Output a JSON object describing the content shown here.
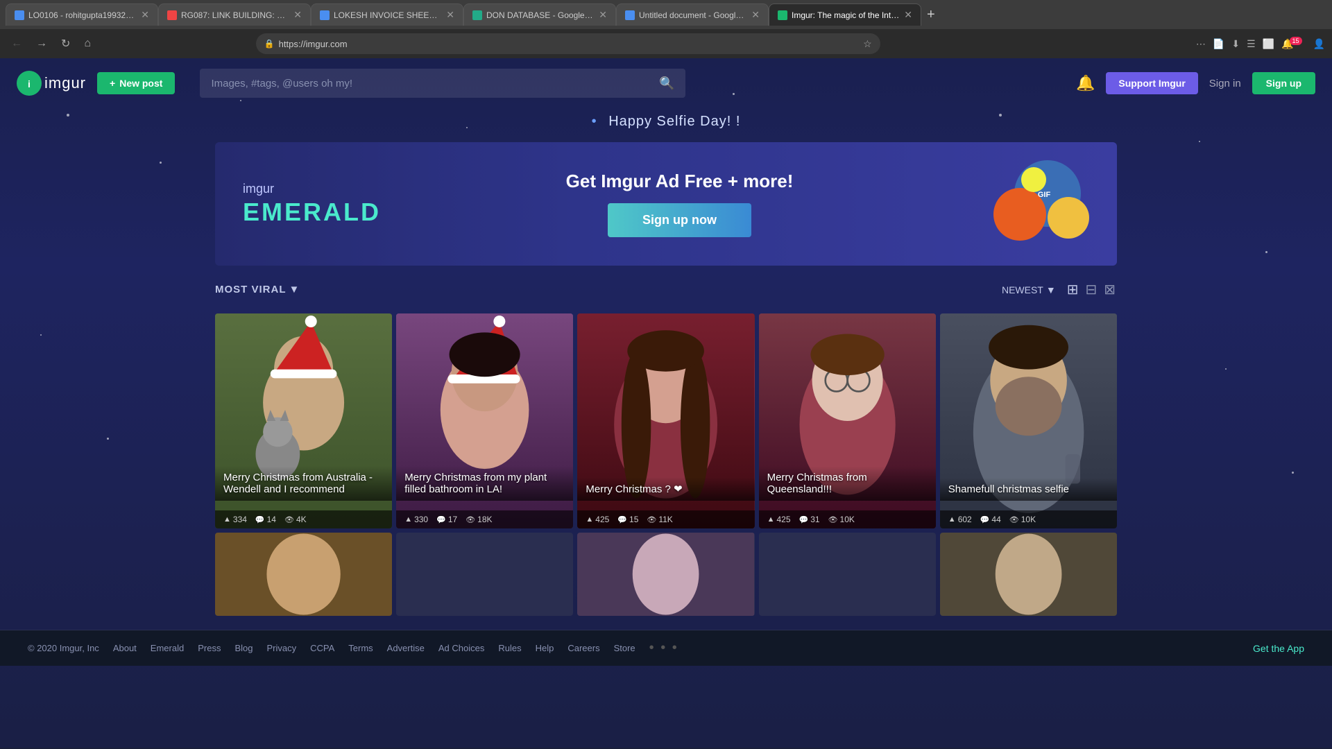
{
  "browser": {
    "tabs": [
      {
        "id": "tab-1",
        "title": "LO0106 - rohitgupta199321@...",
        "favicon_color": "#4a8ef0",
        "active": false
      },
      {
        "id": "tab-2",
        "title": "RG087: LINK BUILDING: CB N...",
        "favicon_color": "#e44",
        "active": false
      },
      {
        "id": "tab-3",
        "title": "LOKESH INVOICE SHEET - Go...",
        "favicon_color": "#4a8ef0",
        "active": false
      },
      {
        "id": "tab-4",
        "title": "DON DATABASE - Google She...",
        "favicon_color": "#2a8",
        "active": false
      },
      {
        "id": "tab-5",
        "title": "Untitled document - Google ...",
        "favicon_color": "#4a8ef0",
        "active": false
      },
      {
        "id": "tab-6",
        "title": "Imgur: The magic of the Inter...",
        "favicon_color": "#1bb76e",
        "active": true
      }
    ],
    "url": "https://imgur.com",
    "badge_count": "15"
  },
  "nav": {
    "logo_text": "imgur",
    "new_post_label": "New post",
    "search_placeholder": "Images, #tags, @users oh my!",
    "support_label": "Support Imgur",
    "signin_label": "Sign in",
    "signup_label": "Sign up"
  },
  "selfie_banner": {
    "text": "Happy Selfie Day!"
  },
  "emerald_banner": {
    "imgur_label": "imgur",
    "emerald_label": "EMERALD",
    "headline": "Get Imgur Ad Free + more!",
    "cta_label": "Sign up now"
  },
  "filter": {
    "most_viral_label": "MOST VIRAL",
    "newest_label": "NEWEST",
    "chevron": "▼"
  },
  "cards": [
    {
      "title": "Merry Christmas from Australia - Wendell and I recommend",
      "ups": "334",
      "comments": "14",
      "views": "4K",
      "img_class": "img-1"
    },
    {
      "title": "Merry Christmas from my plant filled bathroom in LA!",
      "ups": "330",
      "comments": "17",
      "views": "18K",
      "img_class": "img-2"
    },
    {
      "title": "Merry Christmas ? ❤",
      "ups": "425",
      "comments": "15",
      "views": "11K",
      "img_class": "img-3"
    },
    {
      "title": "Merry Christmas from Queensland!!!",
      "ups": "425",
      "comments": "31",
      "views": "10K",
      "img_class": "img-4"
    },
    {
      "title": "Shamefull christmas selfie",
      "ups": "602",
      "comments": "44",
      "views": "10K",
      "img_class": "img-5"
    }
  ],
  "footer": {
    "copyright": "© 2020 Imgur, Inc",
    "links": [
      "About",
      "Emerald",
      "Press",
      "Blog",
      "Privacy",
      "CCPA",
      "Terms",
      "Advertise",
      "Ad Choices",
      "Rules",
      "Help",
      "Careers",
      "Store"
    ],
    "get_app": "Get the App"
  }
}
